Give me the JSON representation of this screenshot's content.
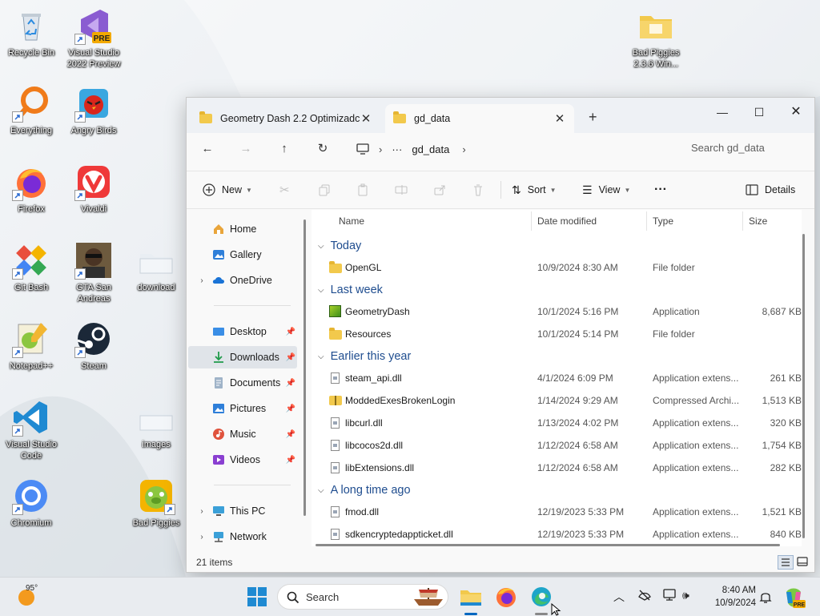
{
  "desktop": {
    "icons": [
      {
        "name": "recycle-bin",
        "label": "Recycle Bin"
      },
      {
        "name": "visual-studio-2022-preview",
        "label": "Visual Studio 2022 Preview"
      },
      {
        "name": "bad-piggies-folder",
        "label": "Bad Piggies 2.3.6 Win..."
      },
      {
        "name": "everything",
        "label": "Everything"
      },
      {
        "name": "angry-birds",
        "label": "Angry Birds"
      },
      {
        "name": "firefox",
        "label": "Firefox"
      },
      {
        "name": "vivaldi",
        "label": "Vivaldi"
      },
      {
        "name": "git-bash",
        "label": "Git Bash"
      },
      {
        "name": "gta-san-andreas",
        "label": "GTA San Andreas"
      },
      {
        "name": "download-folder",
        "label": "download"
      },
      {
        "name": "notepad-plus-plus",
        "label": "Notepad++"
      },
      {
        "name": "steam",
        "label": "Steam"
      },
      {
        "name": "visual-studio-code",
        "label": "Visual Studio Code"
      },
      {
        "name": "images-folder",
        "label": "images"
      },
      {
        "name": "chromium",
        "label": "Chromium"
      },
      {
        "name": "bad-piggies",
        "label": "Bad Piggies"
      }
    ]
  },
  "explorer": {
    "tabs": [
      {
        "label": "Geometry Dash 2.2 Optimizadc",
        "active": false
      },
      {
        "label": "gd_data",
        "active": true
      }
    ],
    "breadcrumb": {
      "more": "···",
      "current": "gd_data"
    },
    "search_placeholder": "Search gd_data",
    "commands": {
      "new": "New",
      "sort": "Sort",
      "view": "View",
      "more": "···",
      "details": "Details"
    },
    "nav": {
      "home": "Home",
      "gallery": "Gallery",
      "onedrive": "OneDrive",
      "desktop": "Desktop",
      "downloads": "Downloads",
      "documents": "Documents",
      "pictures": "Pictures",
      "music": "Music",
      "videos": "Videos",
      "this_pc": "This PC",
      "network": "Network"
    },
    "columns": {
      "name": "Name",
      "date": "Date modified",
      "type": "Type",
      "size": "Size"
    },
    "groups": [
      {
        "label": "Today",
        "files": [
          {
            "icon": "folder",
            "name": "OpenGL",
            "date": "10/9/2024 8:30 AM",
            "type": "File folder",
            "size": ""
          }
        ]
      },
      {
        "label": "Last week",
        "files": [
          {
            "icon": "app",
            "name": "GeometryDash",
            "date": "10/1/2024 5:16 PM",
            "type": "Application",
            "size": "8,687 KB"
          },
          {
            "icon": "folder",
            "name": "Resources",
            "date": "10/1/2024 5:14 PM",
            "type": "File folder",
            "size": ""
          }
        ]
      },
      {
        "label": "Earlier this year",
        "files": [
          {
            "icon": "file",
            "name": "steam_api.dll",
            "date": "4/1/2024 6:09 PM",
            "type": "Application extens...",
            "size": "261 KB"
          },
          {
            "icon": "zip",
            "name": "ModdedExesBrokenLogin",
            "date": "1/14/2024 9:29 AM",
            "type": "Compressed Archi...",
            "size": "1,513 KB"
          },
          {
            "icon": "file",
            "name": "libcurl.dll",
            "date": "1/13/2024 4:02 PM",
            "type": "Application extens...",
            "size": "320 KB"
          },
          {
            "icon": "file",
            "name": "libcocos2d.dll",
            "date": "1/12/2024 6:58 AM",
            "type": "Application extens...",
            "size": "1,754 KB"
          },
          {
            "icon": "file",
            "name": "libExtensions.dll",
            "date": "1/12/2024 6:58 AM",
            "type": "Application extens...",
            "size": "282 KB"
          }
        ]
      },
      {
        "label": "A long time ago",
        "files": [
          {
            "icon": "file",
            "name": "fmod.dll",
            "date": "12/19/2023 5:33 PM",
            "type": "Application extens...",
            "size": "1,521 KB"
          },
          {
            "icon": "file",
            "name": "sdkencryptedappticket.dll",
            "date": "12/19/2023 5:33 PM",
            "type": "Application extens...",
            "size": "840 KB"
          }
        ]
      }
    ],
    "status": "21 items"
  },
  "taskbar": {
    "weather_temp": "95°",
    "search_label": "Search",
    "time": "8:40 AM",
    "date": "10/9/2024"
  },
  "colors": {
    "accent": "#0067c0",
    "folder": "#f2c94c",
    "group_header": "#1f4d8f"
  }
}
